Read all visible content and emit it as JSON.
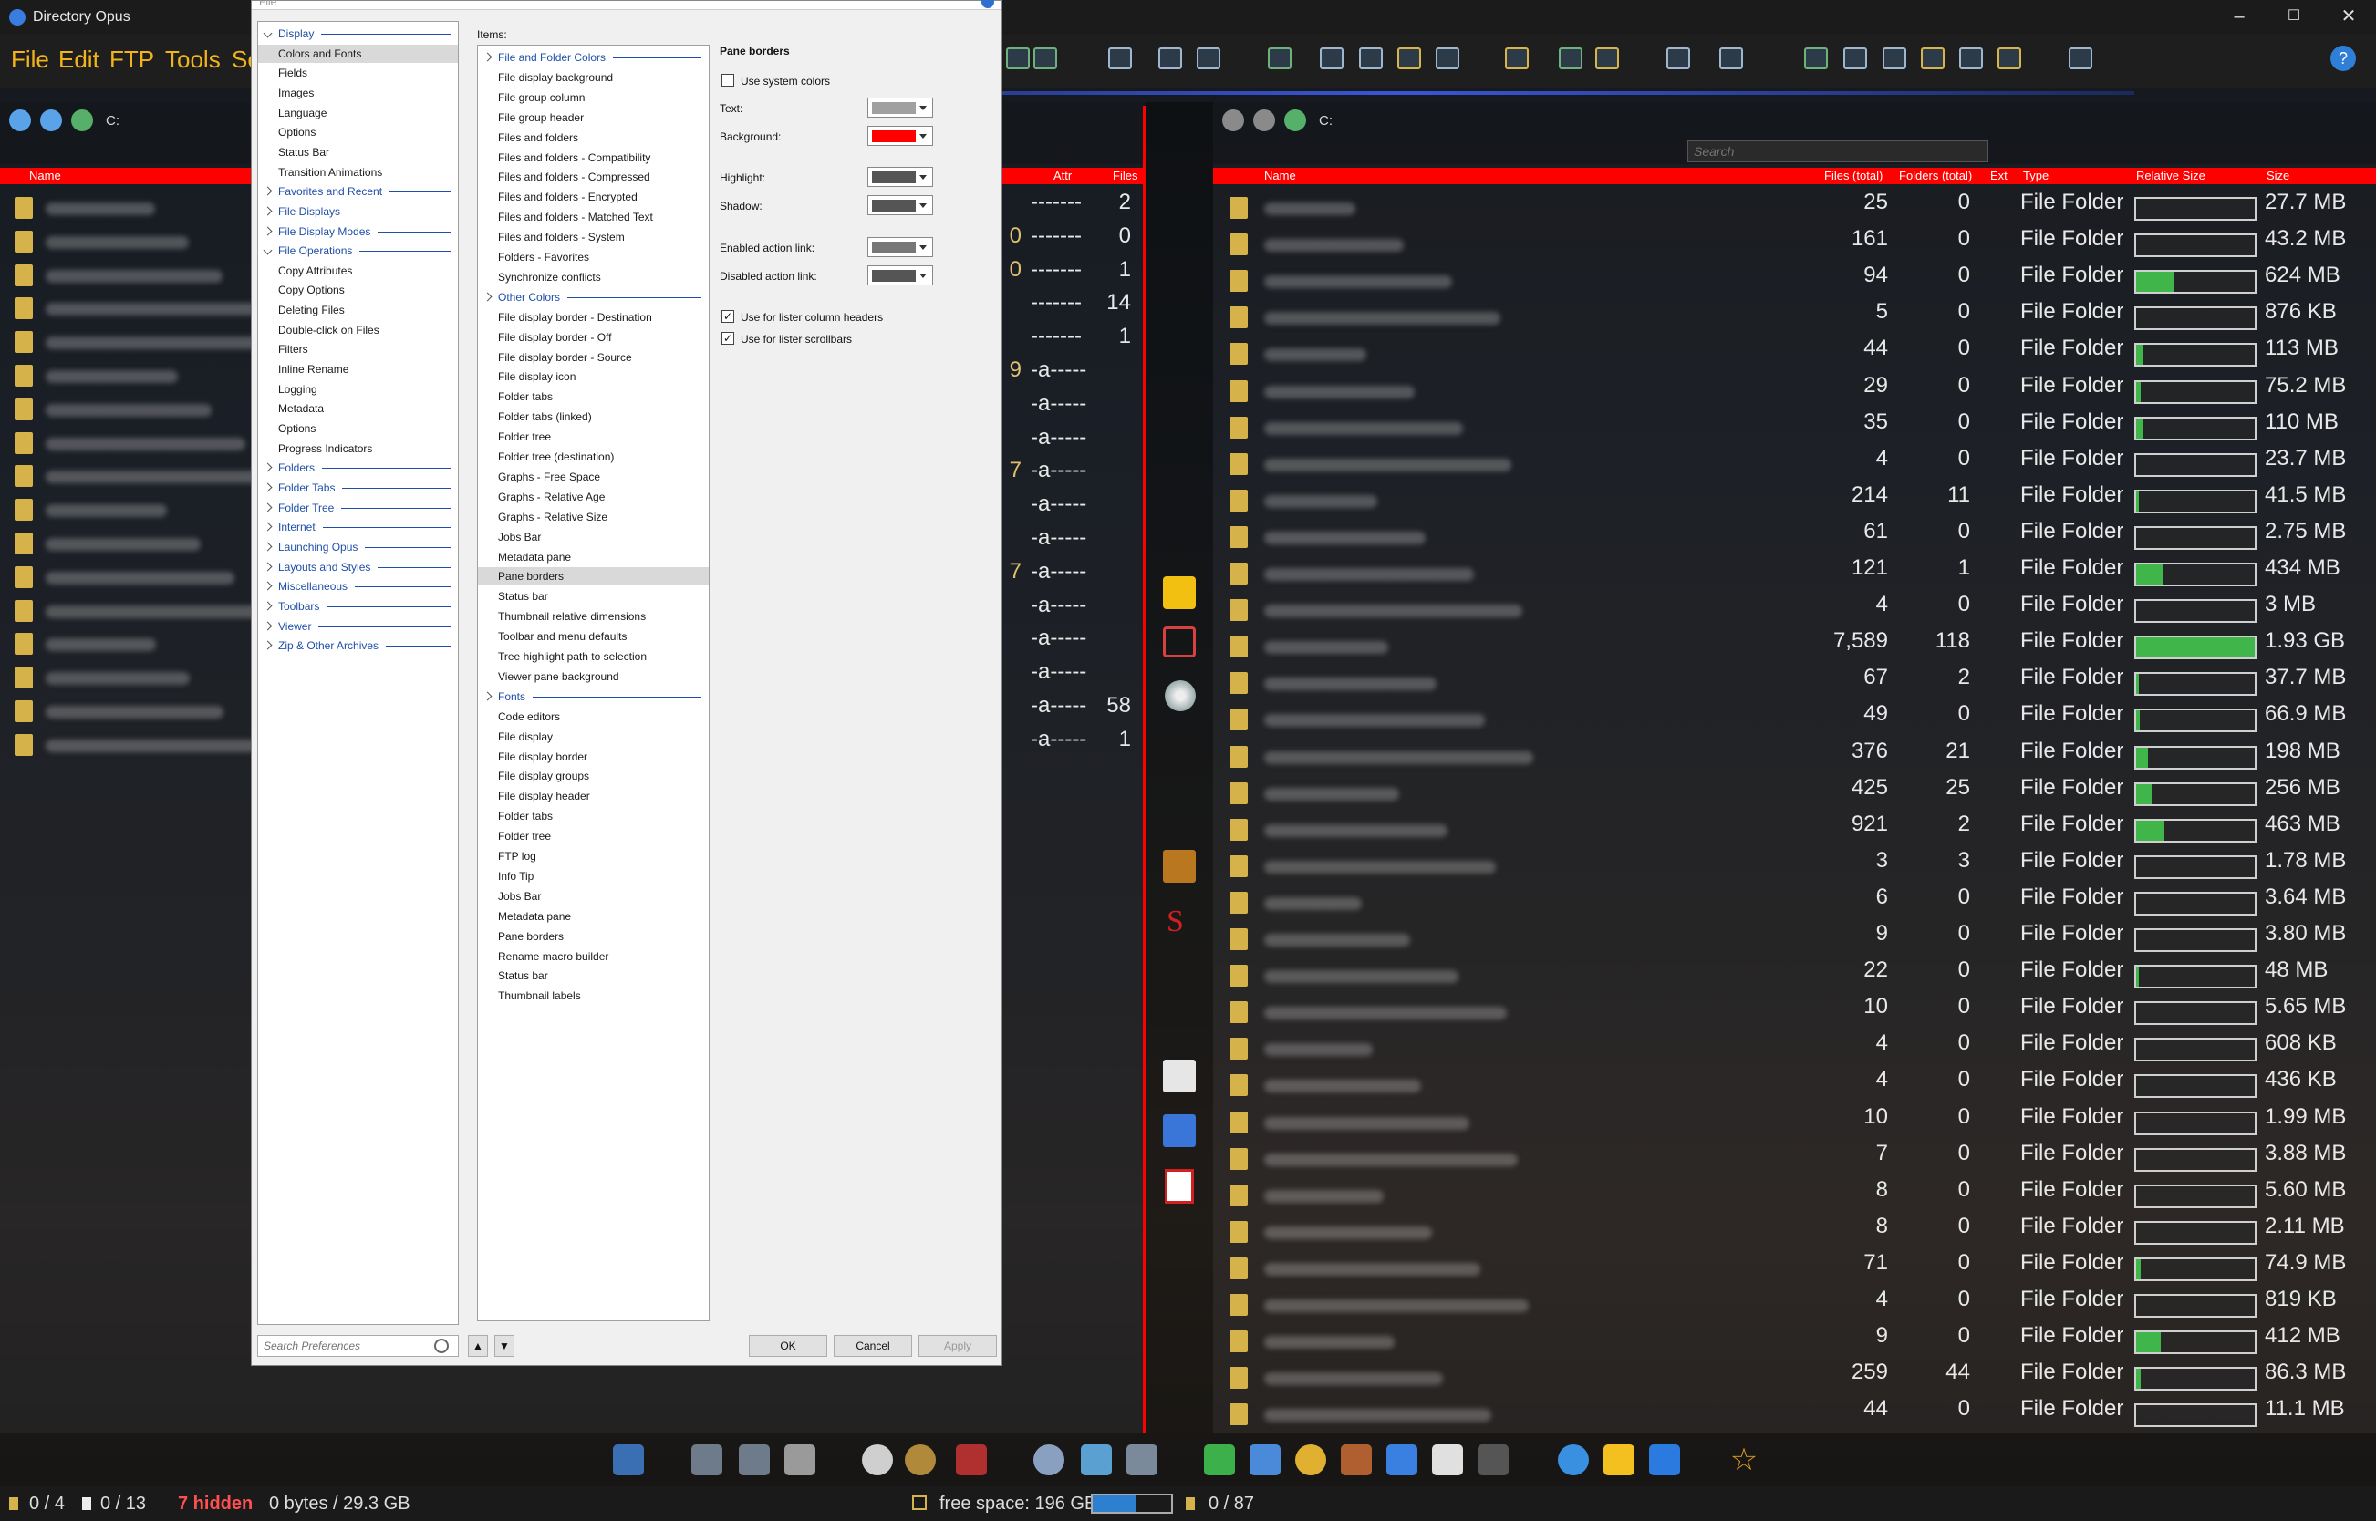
{
  "window": {
    "title": "Directory Opus",
    "minimize": "–",
    "maximize": "☐",
    "close": "✕"
  },
  "menu": {
    "items": [
      "File",
      "Edit",
      "FTP",
      "Tools",
      "Se"
    ],
    "help": "?"
  },
  "left_pane": {
    "path": [
      "C:",
      "    ",
      "  "
    ],
    "header_name": "Name",
    "header_attr": "Attr",
    "header_files": "Files",
    "rows": [
      {
        "attr": "-------",
        "files": "2",
        "extra": ""
      },
      {
        "attr": "-------",
        "files": "0",
        "extra": "0"
      },
      {
        "attr": "-------",
        "files": "1",
        "extra": "0"
      },
      {
        "attr": "-------",
        "files": "14",
        "extra": ""
      },
      {
        "attr": "-------",
        "files": "1",
        "extra": ""
      },
      {
        "attr": "-a-----",
        "files": "",
        "extra": "9"
      },
      {
        "attr": "-a-----",
        "files": "",
        "extra": ""
      },
      {
        "attr": "-a-----",
        "files": "",
        "extra": ""
      },
      {
        "attr": "-a-----",
        "files": "",
        "extra": "7"
      },
      {
        "attr": "-a-----",
        "files": "",
        "extra": ""
      },
      {
        "attr": "-a-----",
        "files": "",
        "extra": ""
      },
      {
        "attr": "-a-----",
        "files": "",
        "extra": "7"
      },
      {
        "attr": "-a-----",
        "files": "",
        "extra": ""
      },
      {
        "attr": "-a-----",
        "files": "",
        "extra": ""
      },
      {
        "attr": "-a-----",
        "files": "",
        "extra": ""
      },
      {
        "attr": "-a-----",
        "files": "58",
        "extra": ""
      },
      {
        "attr": "-a-----",
        "files": "1",
        "extra": ""
      }
    ]
  },
  "right_pane": {
    "path": [
      "C:",
      "    ",
      "    ",
      "    "
    ],
    "search_placeholder": "Search",
    "headers": {
      "name": "Name",
      "files_total": "Files (total)",
      "folders_total": "Folders (total)",
      "ext": "Ext",
      "type": "Type",
      "relsize": "Relative Size",
      "size": "Size"
    },
    "rows": [
      {
        "files": "25",
        "folders": "0",
        "type": "File Folder",
        "rel": 0,
        "size": "27.7 MB"
      },
      {
        "files": "161",
        "folders": "0",
        "type": "File Folder",
        "rel": 0,
        "size": "43.2 MB"
      },
      {
        "files": "94",
        "folders": "0",
        "type": "File Folder",
        "rel": 0.32,
        "size": "624 MB"
      },
      {
        "files": "5",
        "folders": "0",
        "type": "File Folder",
        "rel": 0,
        "size": "876 KB"
      },
      {
        "files": "44",
        "folders": "0",
        "type": "File Folder",
        "rel": 0.06,
        "size": "113 MB"
      },
      {
        "files": "29",
        "folders": "0",
        "type": "File Folder",
        "rel": 0.04,
        "size": "75.2 MB"
      },
      {
        "files": "35",
        "folders": "0",
        "type": "File Folder",
        "rel": 0.06,
        "size": "110 MB"
      },
      {
        "files": "4",
        "folders": "0",
        "type": "File Folder",
        "rel": 0,
        "size": "23.7 MB"
      },
      {
        "files": "214",
        "folders": "11",
        "type": "File Folder",
        "rel": 0.02,
        "size": "41.5 MB"
      },
      {
        "files": "61",
        "folders": "0",
        "type": "File Folder",
        "rel": 0,
        "size": "2.75 MB"
      },
      {
        "files": "121",
        "folders": "1",
        "type": "File Folder",
        "rel": 0.22,
        "size": "434 MB"
      },
      {
        "files": "4",
        "folders": "0",
        "type": "File Folder",
        "rel": 0,
        "size": "3 MB"
      },
      {
        "files": "7,589",
        "folders": "118",
        "type": "File Folder",
        "rel": 1,
        "size": "1.93 GB"
      },
      {
        "files": "67",
        "folders": "2",
        "type": "File Folder",
        "rel": 0.02,
        "size": "37.7 MB"
      },
      {
        "files": "49",
        "folders": "0",
        "type": "File Folder",
        "rel": 0.03,
        "size": "66.9 MB"
      },
      {
        "files": "376",
        "folders": "21",
        "type": "File Folder",
        "rel": 0.1,
        "size": "198 MB"
      },
      {
        "files": "425",
        "folders": "25",
        "type": "File Folder",
        "rel": 0.13,
        "size": "256 MB"
      },
      {
        "files": "921",
        "folders": "2",
        "type": "File Folder",
        "rel": 0.24,
        "size": "463 MB"
      },
      {
        "files": "3",
        "folders": "3",
        "type": "File Folder",
        "rel": 0,
        "size": "1.78 MB"
      },
      {
        "files": "6",
        "folders": "0",
        "type": "File Folder",
        "rel": 0,
        "size": "3.64 MB"
      },
      {
        "files": "9",
        "folders": "0",
        "type": "File Folder",
        "rel": 0,
        "size": "3.80 MB"
      },
      {
        "files": "22",
        "folders": "0",
        "type": "File Folder",
        "rel": 0.02,
        "size": "48 MB"
      },
      {
        "files": "10",
        "folders": "0",
        "type": "File Folder",
        "rel": 0,
        "size": "5.65 MB"
      },
      {
        "files": "4",
        "folders": "0",
        "type": "File Folder",
        "rel": 0,
        "size": "608 KB"
      },
      {
        "files": "4",
        "folders": "0",
        "type": "File Folder",
        "rel": 0,
        "size": "436 KB"
      },
      {
        "files": "10",
        "folders": "0",
        "type": "File Folder",
        "rel": 0,
        "size": "1.99 MB"
      },
      {
        "files": "7",
        "folders": "0",
        "type": "File Folder",
        "rel": 0,
        "size": "3.88 MB"
      },
      {
        "files": "8",
        "folders": "0",
        "type": "File Folder",
        "rel": 0,
        "size": "5.60 MB"
      },
      {
        "files": "8",
        "folders": "0",
        "type": "File Folder",
        "rel": 0,
        "size": "2.11 MB"
      },
      {
        "files": "71",
        "folders": "0",
        "type": "File Folder",
        "rel": 0.04,
        "size": "74.9 MB"
      },
      {
        "files": "4",
        "folders": "0",
        "type": "File Folder",
        "rel": 0,
        "size": "819 KB"
      },
      {
        "files": "9",
        "folders": "0",
        "type": "File Folder",
        "rel": 0.21,
        "size": "412 MB"
      },
      {
        "files": "259",
        "folders": "44",
        "type": "File Folder",
        "rel": 0.04,
        "size": "86.3 MB"
      },
      {
        "files": "44",
        "folders": "0",
        "type": "File Folder",
        "rel": 0,
        "size": "11.1 MB"
      }
    ]
  },
  "dialog": {
    "title": "File",
    "nav": [
      {
        "label": "Display",
        "cat": true,
        "open": true
      },
      {
        "label": "Colors and Fonts",
        "sel": true
      },
      {
        "label": "Fields"
      },
      {
        "label": "Images"
      },
      {
        "label": "Language"
      },
      {
        "label": "Options"
      },
      {
        "label": "Status Bar"
      },
      {
        "label": "Transition Animations"
      },
      {
        "label": "Favorites and Recent",
        "cat": true
      },
      {
        "label": "File Displays",
        "cat": true
      },
      {
        "label": "File Display Modes",
        "cat": true
      },
      {
        "label": "File Operations",
        "cat": true,
        "open": true
      },
      {
        "label": "Copy Attributes"
      },
      {
        "label": "Copy Options"
      },
      {
        "label": "Deleting Files"
      },
      {
        "label": "Double-click on Files"
      },
      {
        "label": "Filters"
      },
      {
        "label": "Inline Rename"
      },
      {
        "label": "Logging"
      },
      {
        "label": "Metadata"
      },
      {
        "label": "Options"
      },
      {
        "label": "Progress Indicators"
      },
      {
        "label": "Folders",
        "cat": true
      },
      {
        "label": "Folder Tabs",
        "cat": true
      },
      {
        "label": "Folder Tree",
        "cat": true
      },
      {
        "label": "Internet",
        "cat": true
      },
      {
        "label": "Launching Opus",
        "cat": true
      },
      {
        "label": "Layouts and Styles",
        "cat": true
      },
      {
        "label": "Miscellaneous",
        "cat": true
      },
      {
        "label": "Toolbars",
        "cat": true
      },
      {
        "label": "Viewer",
        "cat": true
      },
      {
        "label": "Zip & Other Archives",
        "cat": true
      }
    ],
    "items_label": "Items:",
    "items": [
      {
        "label": "File and Folder Colors",
        "cat": true
      },
      {
        "label": "File display background"
      },
      {
        "label": "File group column"
      },
      {
        "label": "File group header"
      },
      {
        "label": "Files and folders"
      },
      {
        "label": "Files and folders - Compatibility"
      },
      {
        "label": "Files and folders - Compressed"
      },
      {
        "label": "Files and folders - Encrypted"
      },
      {
        "label": "Files and folders - Matched Text"
      },
      {
        "label": "Files and folders - System"
      },
      {
        "label": "Folders - Favorites"
      },
      {
        "label": "Synchronize conflicts"
      },
      {
        "label": "Other Colors",
        "cat": true
      },
      {
        "label": "File display border - Destination"
      },
      {
        "label": "File display border - Off"
      },
      {
        "label": "File display border - Source"
      },
      {
        "label": "File display icon"
      },
      {
        "label": "Folder tabs"
      },
      {
        "label": "Folder tabs (linked)"
      },
      {
        "label": "Folder tree"
      },
      {
        "label": "Folder tree (destination)"
      },
      {
        "label": "Graphs - Free Space"
      },
      {
        "label": "Graphs - Relative Age"
      },
      {
        "label": "Graphs - Relative Size"
      },
      {
        "label": "Jobs Bar"
      },
      {
        "label": "Metadata pane"
      },
      {
        "label": "Pane borders",
        "sel": true
      },
      {
        "label": "Status bar"
      },
      {
        "label": "Thumbnail relative dimensions"
      },
      {
        "label": "Toolbar and menu defaults"
      },
      {
        "label": "Tree highlight path to selection"
      },
      {
        "label": "Viewer pane background"
      },
      {
        "label": "Fonts",
        "cat": true
      },
      {
        "label": "Code editors"
      },
      {
        "label": "File display"
      },
      {
        "label": "File display border"
      },
      {
        "label": "File display groups"
      },
      {
        "label": "File display header"
      },
      {
        "label": "Folder tabs"
      },
      {
        "label": "Folder tree"
      },
      {
        "label": "FTP log"
      },
      {
        "label": "Info Tip"
      },
      {
        "label": "Jobs Bar"
      },
      {
        "label": "Metadata pane"
      },
      {
        "label": "Pane borders"
      },
      {
        "label": "Rename macro builder"
      },
      {
        "label": "Status bar"
      },
      {
        "label": "Thumbnail labels"
      }
    ],
    "settings": {
      "heading": "Pane borders",
      "use_system_colors": "Use system colors",
      "text": "Text:",
      "background": "Background:",
      "highlight": "Highlight:",
      "shadow": "Shadow:",
      "enabled_link": "Enabled action link:",
      "disabled_link": "Disabled action link:",
      "use_col_headers": "Use for lister column headers",
      "use_scrollbars": "Use for lister scrollbars",
      "colors": {
        "text": "#a0a0a0",
        "background": "#ff0000",
        "highlight": "#555555",
        "shadow": "#555555",
        "enabled": "#777777",
        "disabled": "#555555"
      }
    },
    "search_placeholder": "Search Preferences",
    "ok": "OK",
    "cancel": "Cancel",
    "apply": "Apply"
  },
  "status": {
    "dirs": "0 / 4",
    "files": "0 / 13",
    "hidden": "7 hidden",
    "bytes": "0 bytes / 29.3 GB",
    "free": "free space: 196 GB",
    "free_fraction": 0.55,
    "right": "0 / 87"
  },
  "accent_color": "#ff0000"
}
